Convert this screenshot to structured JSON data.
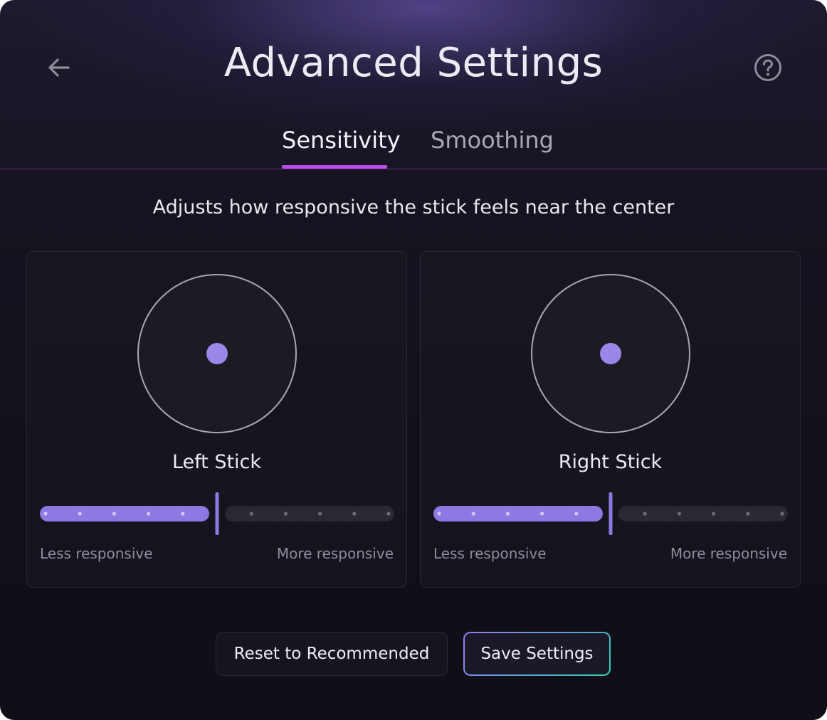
{
  "header": {
    "title": "Advanced Settings",
    "back_icon": "arrow-left-icon",
    "help_icon": "question-circle-icon"
  },
  "tabs": [
    {
      "label": "Sensitivity",
      "active": true
    },
    {
      "label": "Smoothing",
      "active": false
    }
  ],
  "description": "Adjusts how responsive the stick feels near the center",
  "sticks": [
    {
      "name": "Left Stick",
      "value": 0.5,
      "min_label": "Less responsive",
      "max_label": "More responsive"
    },
    {
      "name": "Right Stick",
      "value": 0.5,
      "min_label": "Less responsive",
      "max_label": "More responsive"
    }
  ],
  "buttons": {
    "reset_label": "Reset to Recommended",
    "save_label": "Save Settings"
  },
  "colors": {
    "accent": "#b84dea",
    "slider_fill": "#8d78e4",
    "stick_dot": "#9b87ea",
    "save_border_start": "#9b7cf0",
    "save_border_end": "#2fd1b4"
  }
}
